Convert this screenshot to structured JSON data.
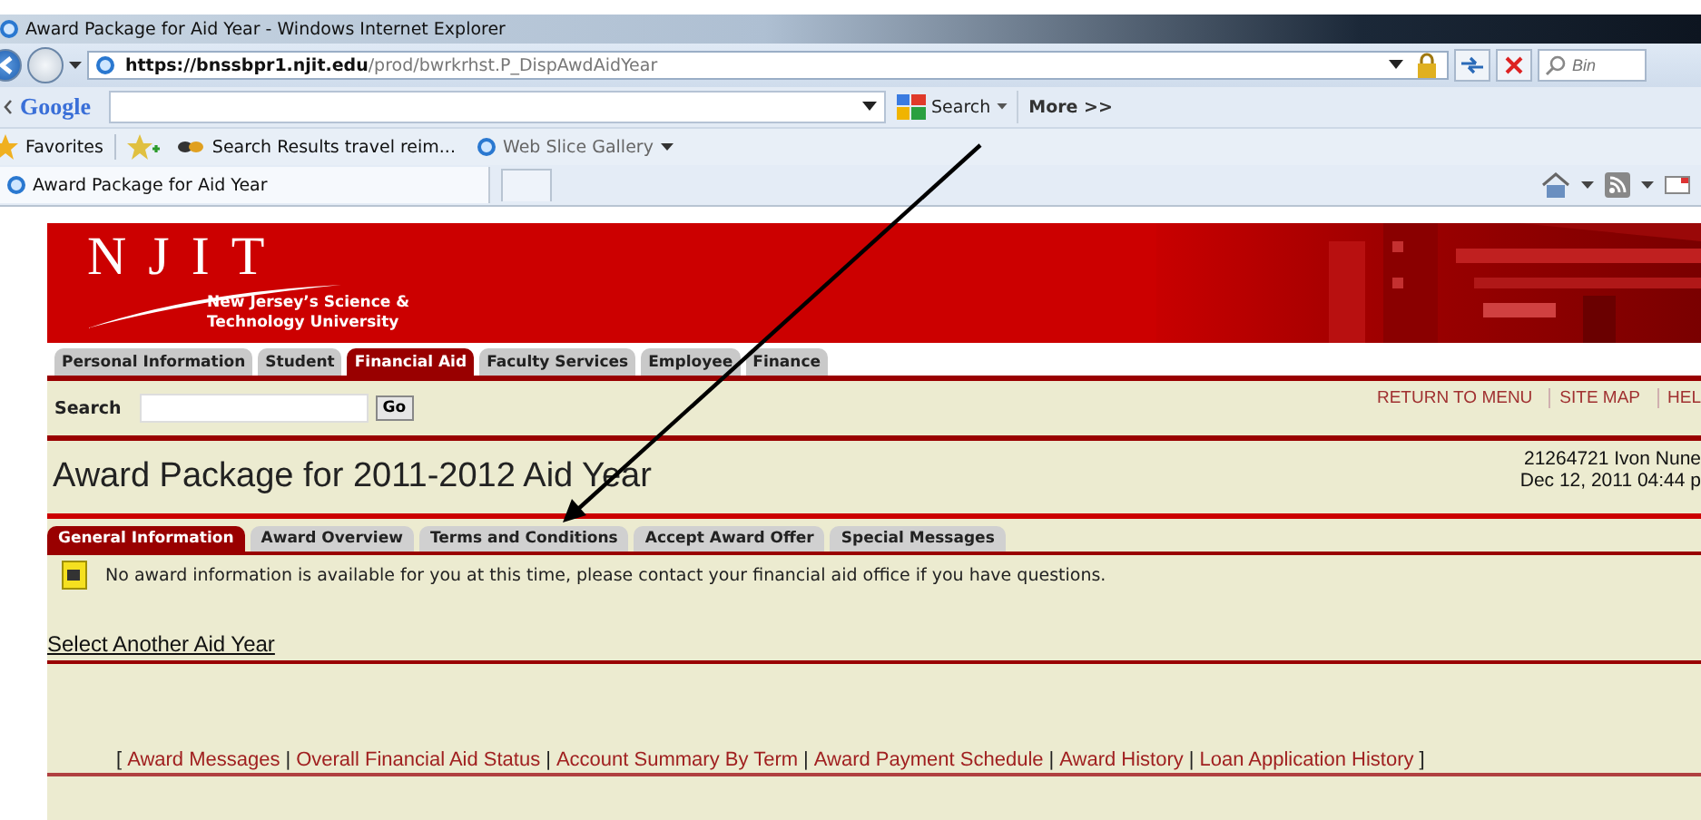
{
  "window": {
    "title": "Award Package for Aid Year - Windows Internet Explorer"
  },
  "address_bar": {
    "url": "**https://bnssbpr1.njit.edu**/prod/bwrkrhst.P_DispAwdAidYear"
  },
  "search_box": {
    "placeholder": "Bin"
  },
  "google_toolbar": {
    "logo": "Google",
    "search_button": "Search",
    "more": "More >>"
  },
  "favorites_bar": {
    "favorites": "Favorites",
    "items": [
      {
        "label": "Search Results travel reim..."
      },
      {
        "label": "Web Slice Gallery"
      }
    ]
  },
  "browser_tabs": [
    {
      "label": "Award Package for Aid Year",
      "selected": true
    }
  ],
  "page": {
    "logo": {
      "letters": "NJIT",
      "tagline": [
        "New Jersey’s Science &",
        "Technology University"
      ]
    },
    "main_tabs": [
      {
        "label": "Personal Information",
        "selected": false
      },
      {
        "label": "Student",
        "selected": false
      },
      {
        "label": "Financial Aid",
        "selected": true
      },
      {
        "label": "Faculty Services",
        "selected": false
      },
      {
        "label": "Employee",
        "selected": false
      },
      {
        "label": "Finance",
        "selected": false
      }
    ],
    "search": {
      "label": "Search",
      "button": "Go"
    },
    "top_links": [
      "RETURN TO MENU",
      "SITE MAP",
      "HEL"
    ],
    "heading": "Award Package for 2011-2012 Aid Year",
    "user_info": [
      "21264721 Ivon Nune",
      "Dec 12, 2011 04:44 p"
    ],
    "sub_tabs": [
      {
        "label": "General Information",
        "selected": true
      },
      {
        "label": "Award Overview",
        "selected": false
      },
      {
        "label": "Terms and Conditions",
        "selected": false
      },
      {
        "label": "Accept Award Offer",
        "selected": false
      },
      {
        "label": "Special Messages",
        "selected": false
      }
    ],
    "info_message": "No award information is available for you at this time, please contact your financial aid office if you have questions.",
    "select_link": "Select Another Aid Year",
    "footer": [
      {
        "kind": "bracket",
        "text": "["
      },
      {
        "kind": "link",
        "text": "Award Messages"
      },
      {
        "kind": "separator",
        "text": "|"
      },
      {
        "kind": "link",
        "text": "Overall Financial Aid Status"
      },
      {
        "kind": "separator",
        "text": "|"
      },
      {
        "kind": "link",
        "text": "Account Summary By Term"
      },
      {
        "kind": "separator",
        "text": "|"
      },
      {
        "kind": "link",
        "text": "Award Payment Schedule"
      },
      {
        "kind": "separator",
        "text": "|"
      },
      {
        "kind": "link",
        "text": "Award History"
      },
      {
        "kind": "separator",
        "text": "|"
      },
      {
        "kind": "link",
        "text": "Loan Application History"
      },
      {
        "kind": "bracket",
        "text": "]"
      }
    ]
  }
}
